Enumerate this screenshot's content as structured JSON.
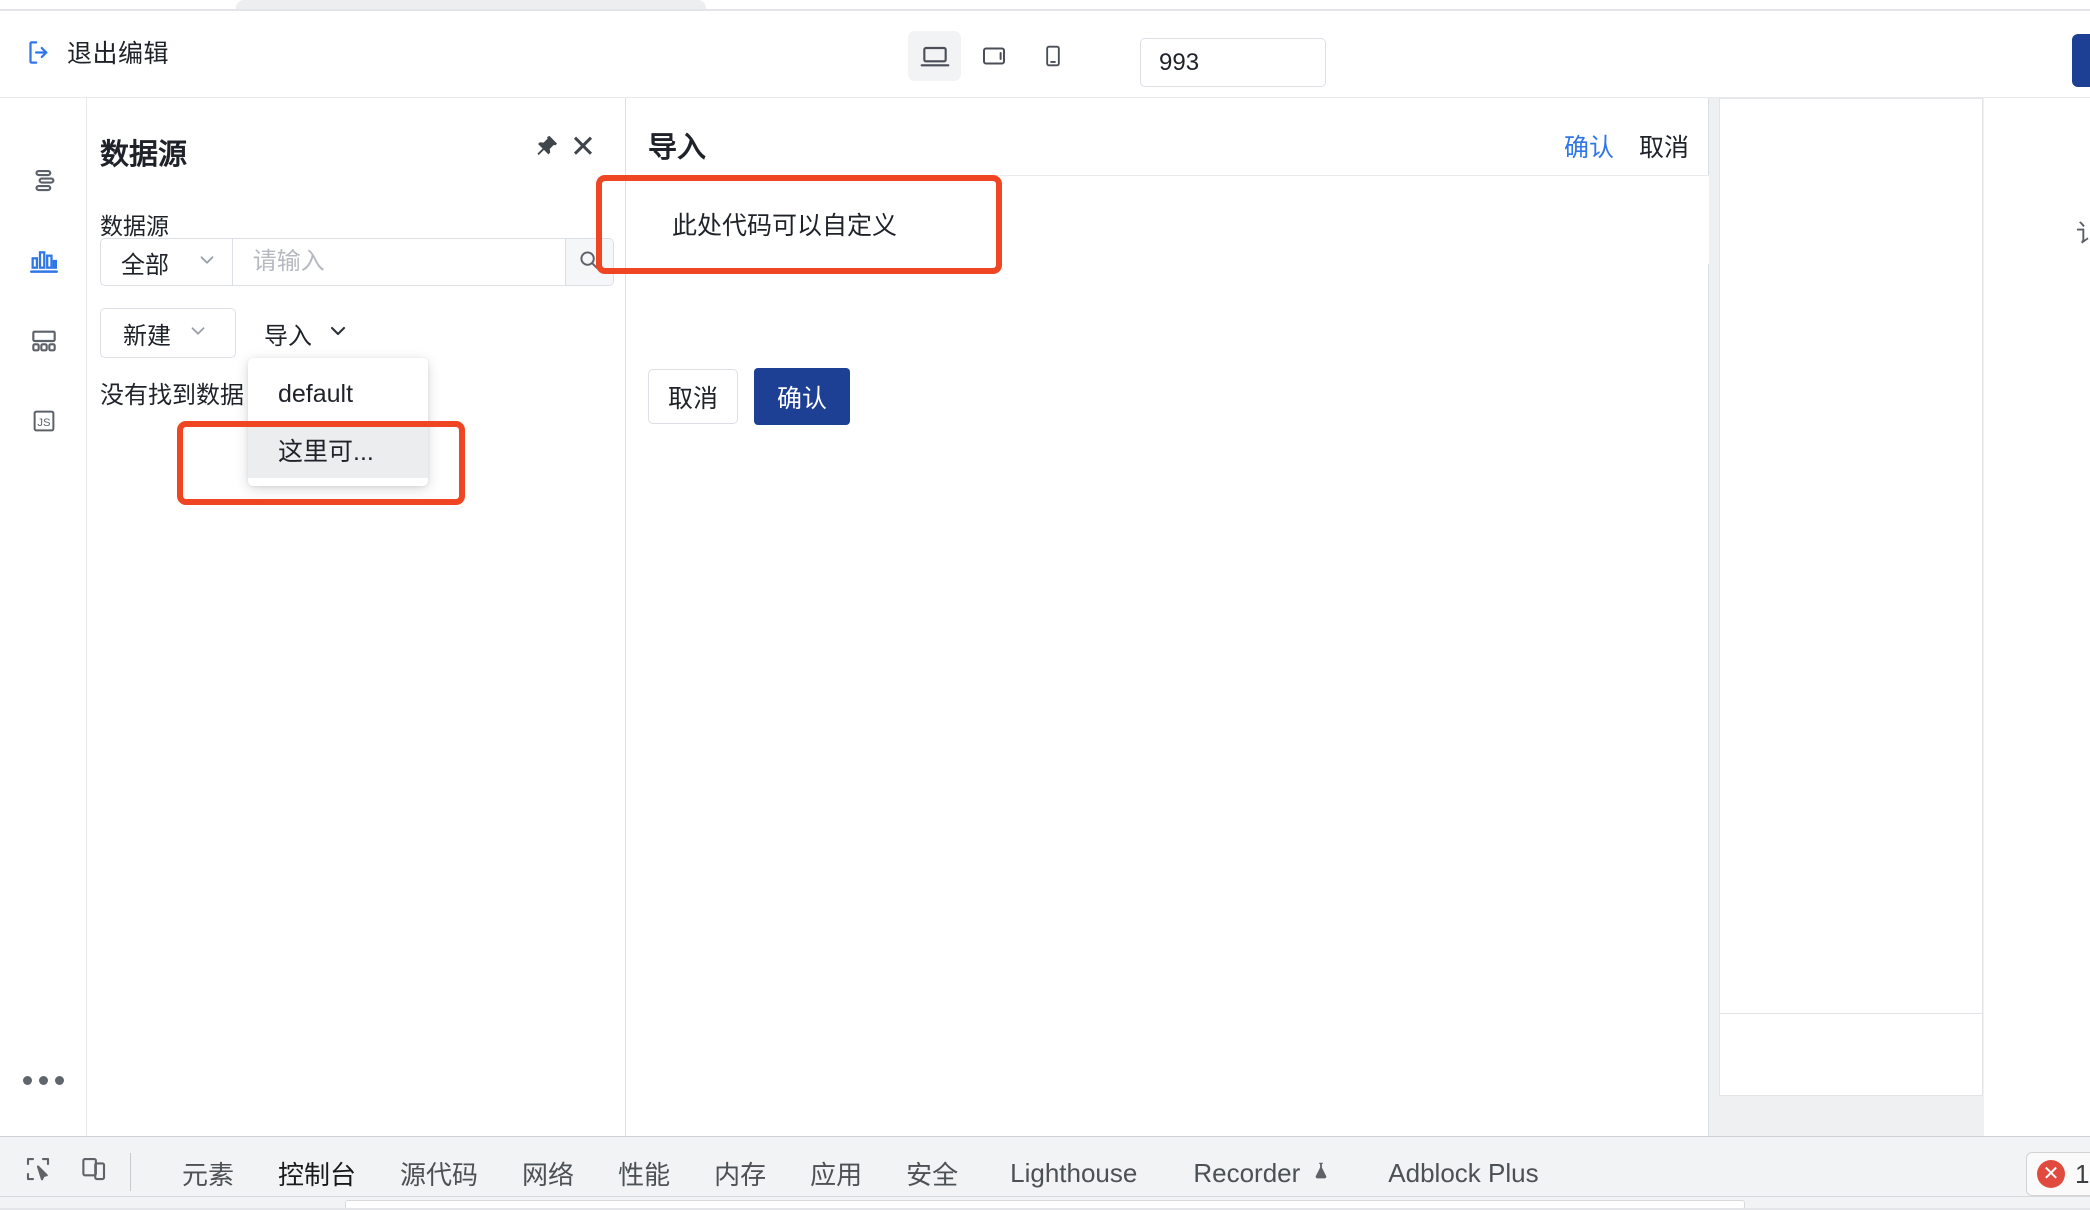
{
  "toolbar": {
    "exit_edit_label": "退出编辑",
    "exit_icon": "exit-door-arrow-icon",
    "devices": [
      {
        "name": "desktop",
        "icon": "laptop-icon",
        "active": true
      },
      {
        "name": "tablet",
        "icon": "tablet-icon",
        "active": false
      },
      {
        "name": "mobile",
        "icon": "mobile-icon",
        "active": false
      }
    ],
    "width_value": "993",
    "width_unit": "px"
  },
  "rail": {
    "items": [
      {
        "name": "layers",
        "icon": "layers-list-icon",
        "active": false
      },
      {
        "name": "data",
        "icon": "bar-chart-icon",
        "active": true
      },
      {
        "name": "layout",
        "icon": "layout-grid-icon",
        "active": false
      },
      {
        "name": "script",
        "icon": "js-icon",
        "label": "JS",
        "active": false
      }
    ],
    "more_icon": "more-dots-icon"
  },
  "datasource_panel": {
    "title": "数据源",
    "pin_icon": "pin-icon",
    "close_icon": "close-icon",
    "field_label": "数据源",
    "select_value": "全部",
    "select_chevron": "chevron-down-icon",
    "search_placeholder": "请输入",
    "search_value": "",
    "search_icon": "search-icon",
    "new_button_label": "新建",
    "import_button_label": "导入",
    "empty_text": "没有找到数据"
  },
  "import_menu": {
    "items": [
      {
        "label": "default",
        "hovered": false
      },
      {
        "label": "这里可...",
        "hovered": true
      }
    ]
  },
  "import_panel": {
    "title": "导入",
    "confirm_link": "确认",
    "cancel_link": "取消",
    "code_text": "此处代码可以自定义",
    "cancel_button": "取消",
    "confirm_button": "确认"
  },
  "devtools": {
    "inspect_icon": "inspect-cursor-icon",
    "device_toggle_icon": "device-toolbar-icon",
    "tabs": [
      {
        "label": "元素",
        "active": false,
        "icon": null
      },
      {
        "label": "控制台",
        "active": true,
        "icon": null
      },
      {
        "label": "源代码",
        "active": false,
        "icon": null
      },
      {
        "label": "网络",
        "active": false,
        "icon": null
      },
      {
        "label": "性能",
        "active": false,
        "icon": null
      },
      {
        "label": "内存",
        "active": false,
        "icon": null
      },
      {
        "label": "应用",
        "active": false,
        "icon": null
      },
      {
        "label": "安全",
        "active": false,
        "icon": null
      },
      {
        "label": "Lighthouse",
        "active": false,
        "icon": null
      },
      {
        "label": "Recorder",
        "active": false,
        "icon": "flask-icon"
      },
      {
        "label": "Adblock Plus",
        "active": false,
        "icon": null
      }
    ],
    "error_count": "1",
    "error_icon": "error-circle-icon"
  },
  "canvas": {
    "edge_char": "讠"
  },
  "colors": {
    "accent_blue": "#2f76e8",
    "primary_navy": "#1d3f94",
    "annotation_red": "#ef4523",
    "devtools_active": "#1a73e8",
    "error_red": "#e04a3f"
  }
}
